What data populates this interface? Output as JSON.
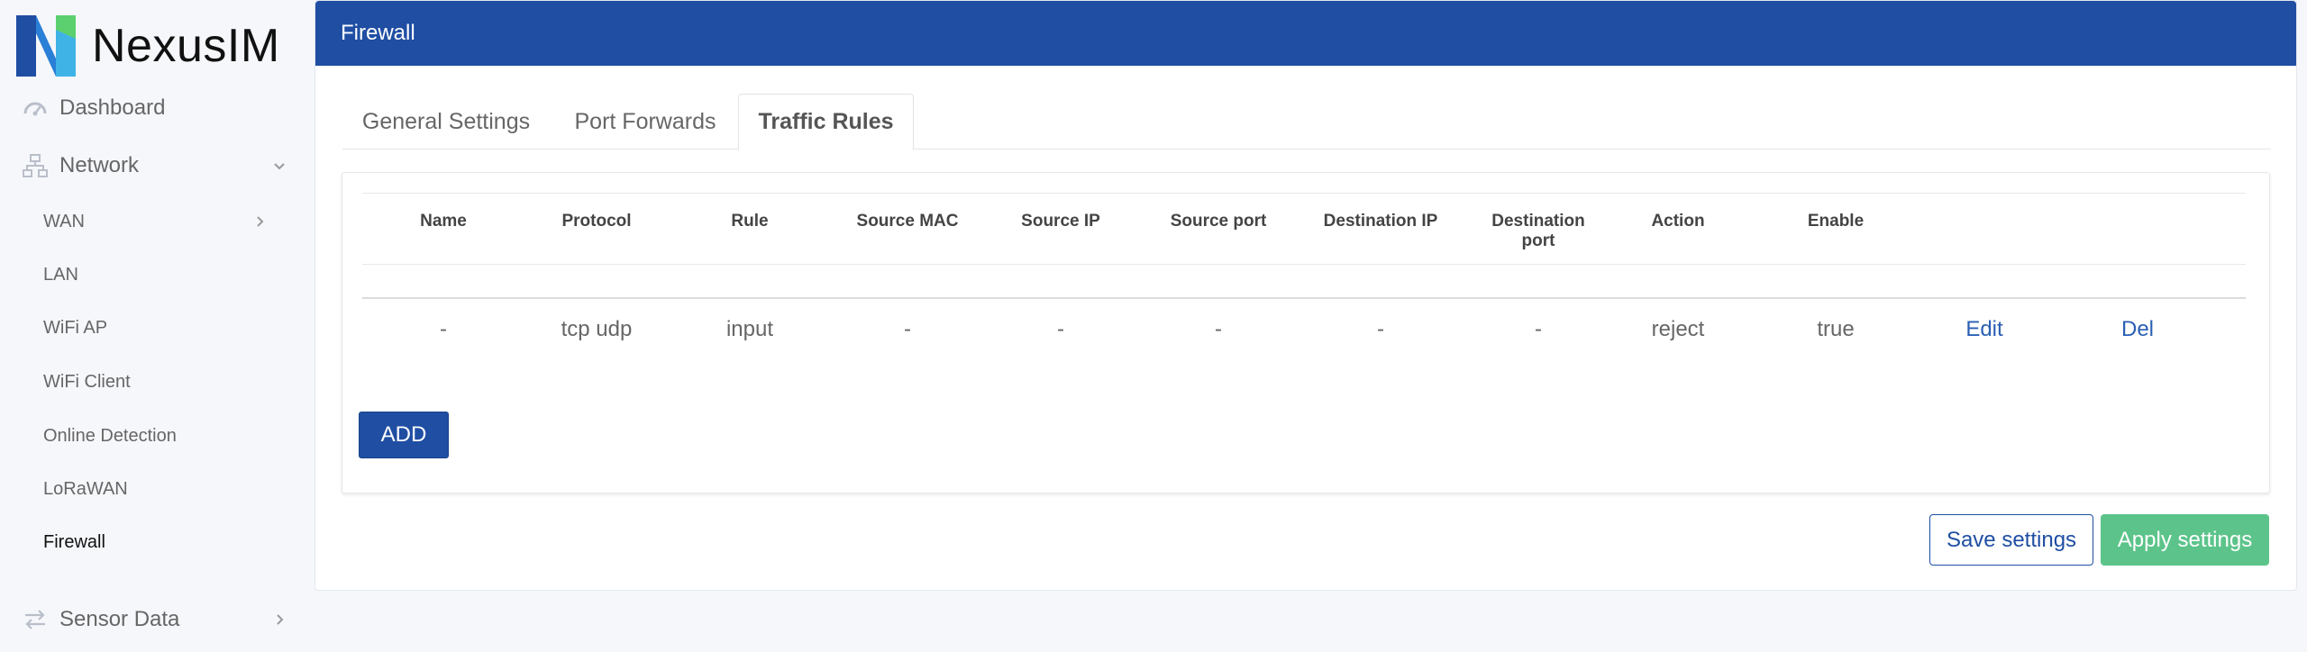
{
  "brand": {
    "name": "NexusIM"
  },
  "sidebar": {
    "top": [
      {
        "label": "Dashboard",
        "icon": "dashboard-icon"
      },
      {
        "label": "Network",
        "icon": "network-icon",
        "expanded": true
      }
    ],
    "network_items": [
      {
        "label": "WAN",
        "has_submenu": true
      },
      {
        "label": "LAN"
      },
      {
        "label": "WiFi AP"
      },
      {
        "label": "WiFi Client"
      },
      {
        "label": "Online Detection"
      },
      {
        "label": "LoRaWAN"
      },
      {
        "label": "Firewall",
        "active": true
      }
    ],
    "bottom": [
      {
        "label": "Sensor Data",
        "icon": "transfer-icon"
      }
    ]
  },
  "page": {
    "title": "Firewall"
  },
  "tabs": [
    {
      "label": "General Settings"
    },
    {
      "label": "Port Forwards"
    },
    {
      "label": "Traffic Rules",
      "active": true
    }
  ],
  "table": {
    "columns": [
      "Name",
      "Protocol",
      "Rule",
      "Source MAC",
      "Source IP",
      "Source port",
      "Destination IP",
      "Destination\nport",
      "Action",
      "Enable"
    ],
    "rows": [
      {
        "name": "-",
        "protocol": "tcp udp",
        "rule": "input",
        "source_mac": "-",
        "source_ip": "-",
        "source_port": "-",
        "destination_ip": "-",
        "destination_port": "-",
        "action": "reject",
        "enable": "true",
        "edit_label": "Edit",
        "del_label": "Del"
      }
    ]
  },
  "buttons": {
    "add": "ADD",
    "save": "Save settings",
    "apply": "Apply settings"
  },
  "colors": {
    "primary": "#1f4ea3",
    "apply": "#5cc48a",
    "link": "#2a5fb4"
  }
}
